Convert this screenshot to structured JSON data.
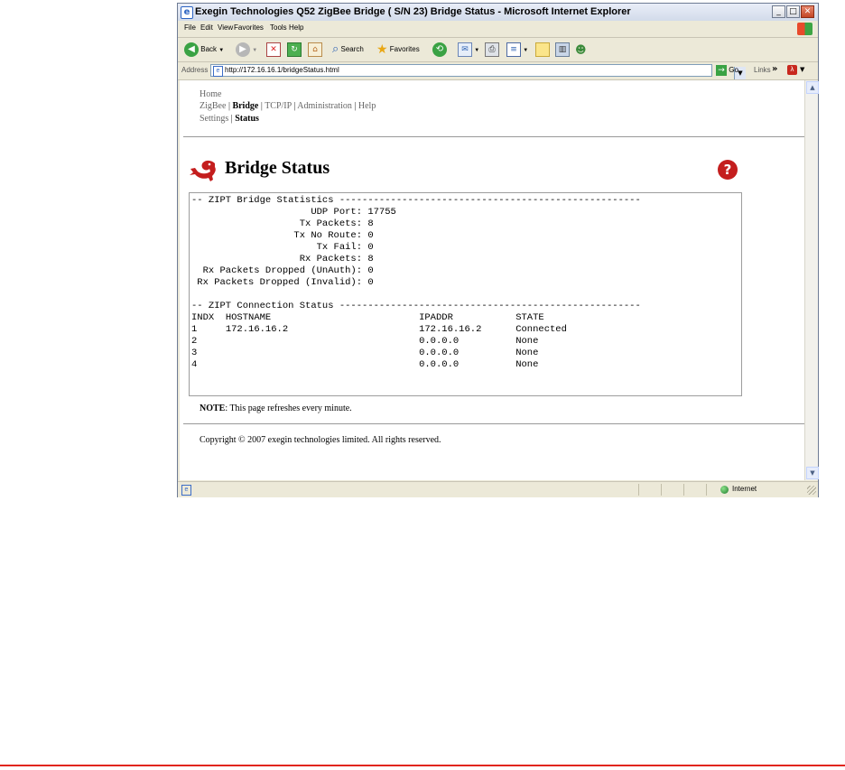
{
  "window": {
    "title": "Exegin Technologies Q52 ZigBee Bridge ( S/N 23) Bridge Status - Microsoft Internet Explorer",
    "minimize": "_",
    "maximize": "□",
    "close": "✕"
  },
  "menu": [
    "File",
    "Edit",
    "View",
    "Favorites",
    "Tools",
    "Help"
  ],
  "toolbar": {
    "back_label": "Back",
    "search_label": "Search",
    "favorites_label": "Favorites"
  },
  "address": {
    "label": "Address",
    "url": "http://172.16.16.1/bridgeStatus.html",
    "go_label": "Go",
    "links_label": "Links"
  },
  "nav": {
    "home": "Home",
    "zigbee": "ZigBee",
    "bridge": "Bridge",
    "tcpip": "TCP/IP",
    "administration": "Administration",
    "help": "Help",
    "settings": "Settings",
    "status": "Status",
    "separator": "|"
  },
  "page": {
    "title": "Bridge Status",
    "help_icon": "?"
  },
  "stats": {
    "header": "-- ZIPT Bridge Statistics -----------------------------------------------------",
    "rows": [
      {
        "label": "UDP Port:",
        "value": "17755"
      },
      {
        "label": "Tx Packets:",
        "value": "8"
      },
      {
        "label": "Tx No Route:",
        "value": "0"
      },
      {
        "label": "Tx Fail:",
        "value": "0"
      },
      {
        "label": "Rx Packets:",
        "value": "8"
      },
      {
        "label": "Rx Packets Dropped (UnAuth):",
        "value": "0"
      },
      {
        "label": "Rx Packets Dropped (Invalid):",
        "value": "0"
      }
    ]
  },
  "connections": {
    "header": "-- ZIPT Connection Status -----------------------------------------------------",
    "columns": [
      "INDX",
      "HOSTNAME",
      "IPADDR",
      "STATE"
    ],
    "rows": [
      {
        "indx": "1",
        "hostname": "172.16.16.2",
        "ipaddr": "172.16.16.2",
        "state": "Connected"
      },
      {
        "indx": "2",
        "hostname": "",
        "ipaddr": "0.0.0.0",
        "state": "None"
      },
      {
        "indx": "3",
        "hostname": "",
        "ipaddr": "0.0.0.0",
        "state": "None"
      },
      {
        "indx": "4",
        "hostname": "",
        "ipaddr": "0.0.0.0",
        "state": "None"
      }
    ]
  },
  "note": {
    "label": "NOTE",
    "text": ": This page refreshes every minute."
  },
  "copyright": "Copyright © 2007 exegin technologies limited. All rights reserved.",
  "statusbar": {
    "zone": "Internet"
  },
  "colors": {
    "accent_red": "#e1251b",
    "logo_red": "#c41e1e"
  }
}
